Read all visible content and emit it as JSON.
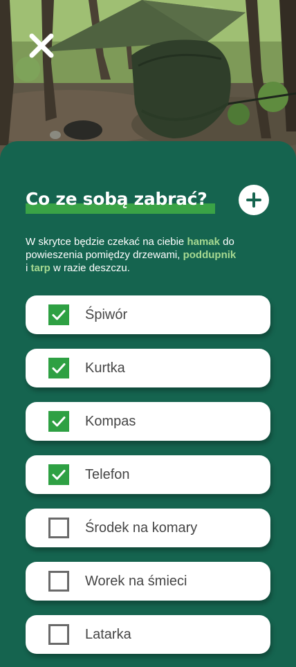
{
  "header": {
    "close_icon": "close-icon",
    "photo": "hammock-tarp-forest-photo"
  },
  "section": {
    "title": "Co ze sobą zabrać?",
    "add_icon": "plus-icon",
    "description": {
      "t1": "W skrytce będzie czekać na ciebie ",
      "hamak": "hamak",
      "t2": " do powieszenia pomiędzy drzewami, ",
      "poddupnik": "poddupnik",
      "t3": " i ",
      "tarp": "tarp",
      "t4": " w razie deszczu."
    }
  },
  "checklist": [
    {
      "label": "Śpiwór",
      "checked": true
    },
    {
      "label": "Kurtka",
      "checked": true
    },
    {
      "label": "Kompas",
      "checked": true
    },
    {
      "label": "Telefon",
      "checked": true
    },
    {
      "label": "Środek na komary",
      "checked": false
    },
    {
      "label": "Worek na śmieci",
      "checked": false
    },
    {
      "label": "Latarka",
      "checked": false
    }
  ],
  "colors": {
    "background": "#15644f",
    "accent_green": "#3aa346",
    "checkbox_green": "#2ea043",
    "highlight_text": "#a6d991"
  }
}
